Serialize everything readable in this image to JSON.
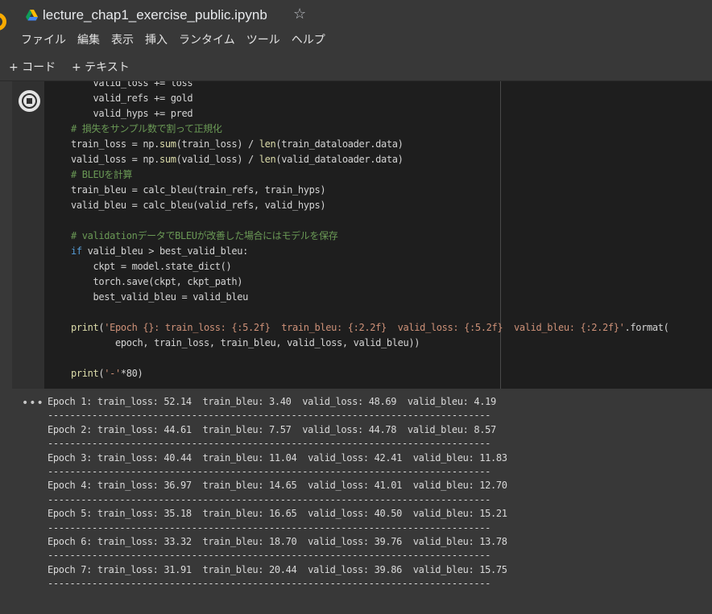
{
  "notebook": {
    "title": "lecture_chap1_exercise_public.ipynb"
  },
  "menu": [
    "ファイル",
    "編集",
    "表示",
    "挿入",
    "ランタイム",
    "ツール",
    "ヘルプ"
  ],
  "toolbar": {
    "add_code": "+ コード",
    "add_text": "+ テキスト"
  },
  "code_lines": [
    [
      {
        "t": "    valid_loss += loss"
      }
    ],
    [
      {
        "t": "    valid_refs += gold"
      }
    ],
    [
      {
        "t": "    valid_hyps += pred"
      }
    ],
    [
      {
        "t": "# 損失をサンプル数で割って正規化",
        "c": "cm"
      }
    ],
    [
      {
        "t": "train_loss = np."
      },
      {
        "t": "sum",
        "c": "fn"
      },
      {
        "t": "(train_loss) / "
      },
      {
        "t": "len",
        "c": "fn"
      },
      {
        "t": "(train_dataloader.data)"
      }
    ],
    [
      {
        "t": "valid_loss = np."
      },
      {
        "t": "sum",
        "c": "fn"
      },
      {
        "t": "(valid_loss) / "
      },
      {
        "t": "len",
        "c": "fn"
      },
      {
        "t": "(valid_dataloader.data)"
      }
    ],
    [
      {
        "t": "# BLEUを計算",
        "c": "cm"
      }
    ],
    [
      {
        "t": "train_bleu = calc_bleu(train_refs, train_hyps)"
      }
    ],
    [
      {
        "t": "valid_bleu = calc_bleu(valid_refs, valid_hyps)"
      }
    ],
    [
      {
        "t": ""
      }
    ],
    [
      {
        "t": "# validationデータでBLEUが改善した場合にはモデルを保存",
        "c": "cm"
      }
    ],
    [
      {
        "t": "if",
        "c": "kw"
      },
      {
        "t": " valid_bleu > best_valid_bleu:"
      }
    ],
    [
      {
        "t": "    ckpt = model.state_dict()"
      }
    ],
    [
      {
        "t": "    torch.save(ckpt, ckpt_path)"
      }
    ],
    [
      {
        "t": "    best_valid_bleu = valid_bleu"
      }
    ],
    [
      {
        "t": ""
      }
    ],
    [
      {
        "t": "print",
        "c": "fn"
      },
      {
        "t": "("
      },
      {
        "t": "'Epoch {}: train_loss: {:5.2f}  train_bleu: {:2.2f}  valid_loss: {:5.2f}  valid_bleu: {:2.2f}'",
        "c": "str"
      },
      {
        "t": ".format("
      }
    ],
    [
      {
        "t": "        epoch, train_loss, train_bleu, valid_loss, valid_bleu))"
      }
    ],
    [
      {
        "t": ""
      }
    ],
    [
      {
        "t": "print",
        "c": "fn"
      },
      {
        "t": "("
      },
      {
        "t": "'-'",
        "c": "str"
      },
      {
        "t": "*80)"
      }
    ]
  ],
  "output": {
    "more_label": "•••",
    "lines": [
      "Epoch 1: train_loss: 52.14  train_bleu: 3.40  valid_loss: 48.69  valid_bleu: 4.19",
      "--------------------------------------------------------------------------------",
      "Epoch 2: train_loss: 44.61  train_bleu: 7.57  valid_loss: 44.78  valid_bleu: 8.57",
      "--------------------------------------------------------------------------------",
      "Epoch 3: train_loss: 40.44  train_bleu: 11.04  valid_loss: 42.41  valid_bleu: 11.83",
      "--------------------------------------------------------------------------------",
      "Epoch 4: train_loss: 36.97  train_bleu: 14.65  valid_loss: 41.01  valid_bleu: 12.70",
      "--------------------------------------------------------------------------------",
      "Epoch 5: train_loss: 35.18  train_bleu: 16.65  valid_loss: 40.50  valid_bleu: 15.21",
      "--------------------------------------------------------------------------------",
      "Epoch 6: train_loss: 33.32  train_bleu: 18.70  valid_loss: 39.76  valid_bleu: 13.78",
      "--------------------------------------------------------------------------------",
      "Epoch 7: train_loss: 31.91  train_bleu: 20.44  valid_loss: 39.86  valid_bleu: 15.75",
      "--------------------------------------------------------------------------------"
    ]
  },
  "icons": {
    "drive": "google-drive-icon",
    "star": "star-outline-icon",
    "run": "stop-execution-icon",
    "colab_logo": "colab-logo-icon"
  }
}
